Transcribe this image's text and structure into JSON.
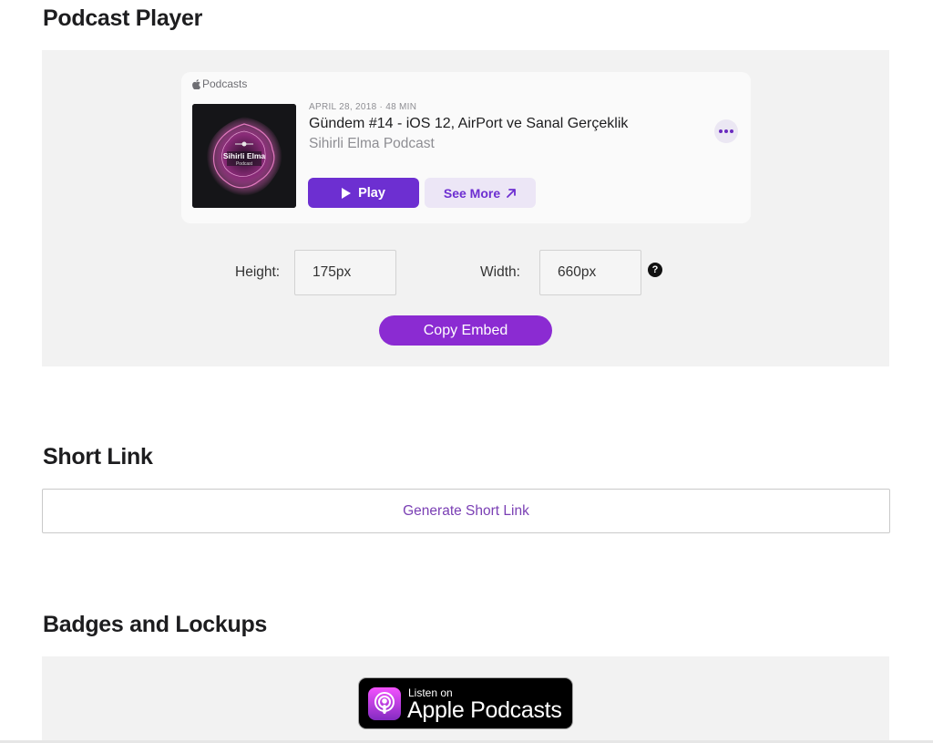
{
  "sections": {
    "player_title": "Podcast Player",
    "short_link_title": "Short Link",
    "badges_title": "Badges and Lockups"
  },
  "embed": {
    "brand": "Podcasts",
    "date_duration": "APRIL 28, 2018 · 48 MIN",
    "episode_title": "Gündem #14 - iOS 12, AirPort ve Sanal Gerçeklik",
    "show_name": "Sihirli Elma Podcast",
    "artwork_text_main": "Sihirli Elma",
    "artwork_text_sub": "Podcast",
    "play_label": "Play",
    "see_more_label": "See More"
  },
  "dimensions": {
    "height_label": "Height:",
    "height_value": "175px",
    "width_label": "Width:",
    "width_value": "660px",
    "help_glyph": "?"
  },
  "copy_embed_label": "Copy Embed",
  "short_link_button": "Generate Short Link",
  "badge": {
    "small_text": "Listen on",
    "big_text": "Apple Podcasts"
  },
  "colors": {
    "play_button": "#6d2fd1",
    "copy_embed": "#8b2bd2",
    "short_link_text": "#7a3fb4",
    "panel_background": "#f2f2f2"
  },
  "icons": [
    "apple-logo-icon",
    "more-icon",
    "play-icon",
    "arrow-up-right-icon",
    "help-icon",
    "podcasts-app-icon"
  ]
}
